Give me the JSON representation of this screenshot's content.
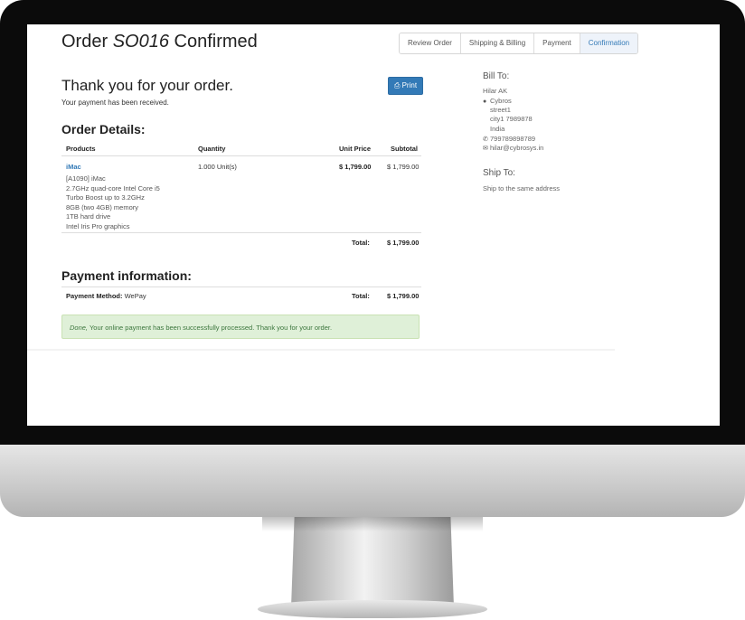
{
  "page": {
    "title_prefix": "Order",
    "title_order": "SO016",
    "title_suffix": "Confirmed"
  },
  "wizard": [
    "Review Order",
    "Shipping & Billing",
    "Payment",
    "Confirmation"
  ],
  "thanks": "Thank you for your order.",
  "received": "Your payment has been received.",
  "print_label": "Print",
  "order_details": {
    "heading": "Order Details:",
    "headers": {
      "products": "Products",
      "quantity": "Quantity",
      "unit_price": "Unit Price",
      "subtotal": "Subtotal"
    },
    "line": {
      "name": "iMac",
      "description": [
        "[A1090] iMac",
        "2.7GHz quad-core Intel Core i5",
        "Turbo Boost up to 3.2GHz",
        "8GB (two 4GB) memory",
        "1TB hard drive",
        "Intel Iris Pro graphics"
      ],
      "quantity": "1.000 Unit(s)",
      "unit_price": "$ 1,799.00",
      "subtotal": "$ 1,799.00"
    },
    "total_label": "Total:",
    "total": "$ 1,799.00"
  },
  "payment": {
    "heading": "Payment information:",
    "method_label": "Payment Method:",
    "method": "WePay",
    "total_label": "Total:",
    "total": "$ 1,799.00",
    "alert_em": "Done,",
    "alert_text": "Your online payment has been successfully processed. Thank you for your order."
  },
  "bill_to": {
    "heading": "Bill To:",
    "name": "Hilar AK",
    "company": "Cybros",
    "street": "street1",
    "city": "city1 7989878",
    "country": "India",
    "phone": "799789898789",
    "email": "hilar@cybrosys.in"
  },
  "ship_to": {
    "heading": "Ship To:",
    "text": "Ship to the same address"
  },
  "colors": {
    "primary": "#337ab7",
    "success_bg": "#dff0d8",
    "success_text": "#3c763d"
  }
}
